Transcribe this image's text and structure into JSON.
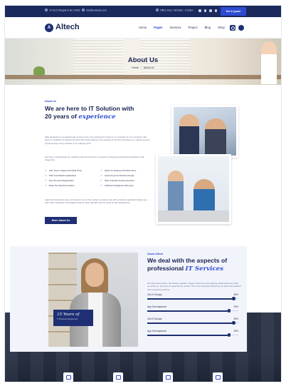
{
  "topbar": {
    "address": "24 Tech Rangeli el Ne 10002",
    "email": "info@example.com",
    "hours": "Office Hour: 08:00am - 6:00pm",
    "quote_label": "Get A Quote"
  },
  "navbar": {
    "logo_letter": "A",
    "brand": "Altech",
    "items": [
      {
        "label": "Home",
        "active": false
      },
      {
        "label": "Pages",
        "active": true
      },
      {
        "label": "Services",
        "active": false
      },
      {
        "label": "Project",
        "active": false
      },
      {
        "label": "Blog",
        "active": false
      },
      {
        "label": "Shop",
        "active": false
      }
    ],
    "icons": [
      "search-icon",
      "cart-icon"
    ]
  },
  "hero": {
    "title": "About Us",
    "breadcrumb": [
      "Home",
      "About Us"
    ]
  },
  "about": {
    "tag": "About Us",
    "heading_1": "We are here to IT Solution with",
    "heading_2": "20 years of",
    "heading_em": "experience",
    "para1": "Web designing in a powerful way of just not an only professions however, in a passion for our Company. We have to a tradition to believe the idea that smart looking of any website is the first impression on visitors and the simple design of any website is the starting point.",
    "para2": "We have a special team for website style who has been involved in designing professional websites of all categories.",
    "features": [
      "24/7 Hours Support Flexible Price",
      "Quick To Respond Flexible Price",
      "Web And Mobile Application",
      "Improving Our Website Design",
      "New Domain Registration",
      "Web & Email Hosting Services",
      "Data Test Synchronization",
      "Artificial Intelligence Web App"
    ],
    "para3": "High-Tech Industries play an important role in the modern economy and offer excellent significant higher pay than other industries. And Digital solutions have transformed the world of web applications.",
    "button_label": "More About Us"
  },
  "aspects": {
    "tag": "About Altech",
    "heading_1": "We deal with the aspects of",
    "heading_2": "professional",
    "heading_em": "IT Services",
    "para": "We listen first service. We design together. Happy customers and ongoing relationships are what we strive for. Success is measured by results. The most important being how our clients illuminated their experience with us.",
    "years_badge": "15 Years of",
    "years_sub": "IT Business Experience",
    "skills": [
      {
        "name": "UI/UX Design",
        "value": "95%",
        "percent": 95
      },
      {
        "name": "App Development",
        "value": "90%",
        "percent": 90
      },
      {
        "name": "UI/UX Design",
        "value": "95%",
        "percent": 95
      },
      {
        "name": "App Development",
        "value": "90%",
        "percent": 90
      }
    ]
  },
  "colors": {
    "navy": "#1e2f73",
    "accent": "#2d4bd1",
    "topbar": "#1a2a5c"
  }
}
